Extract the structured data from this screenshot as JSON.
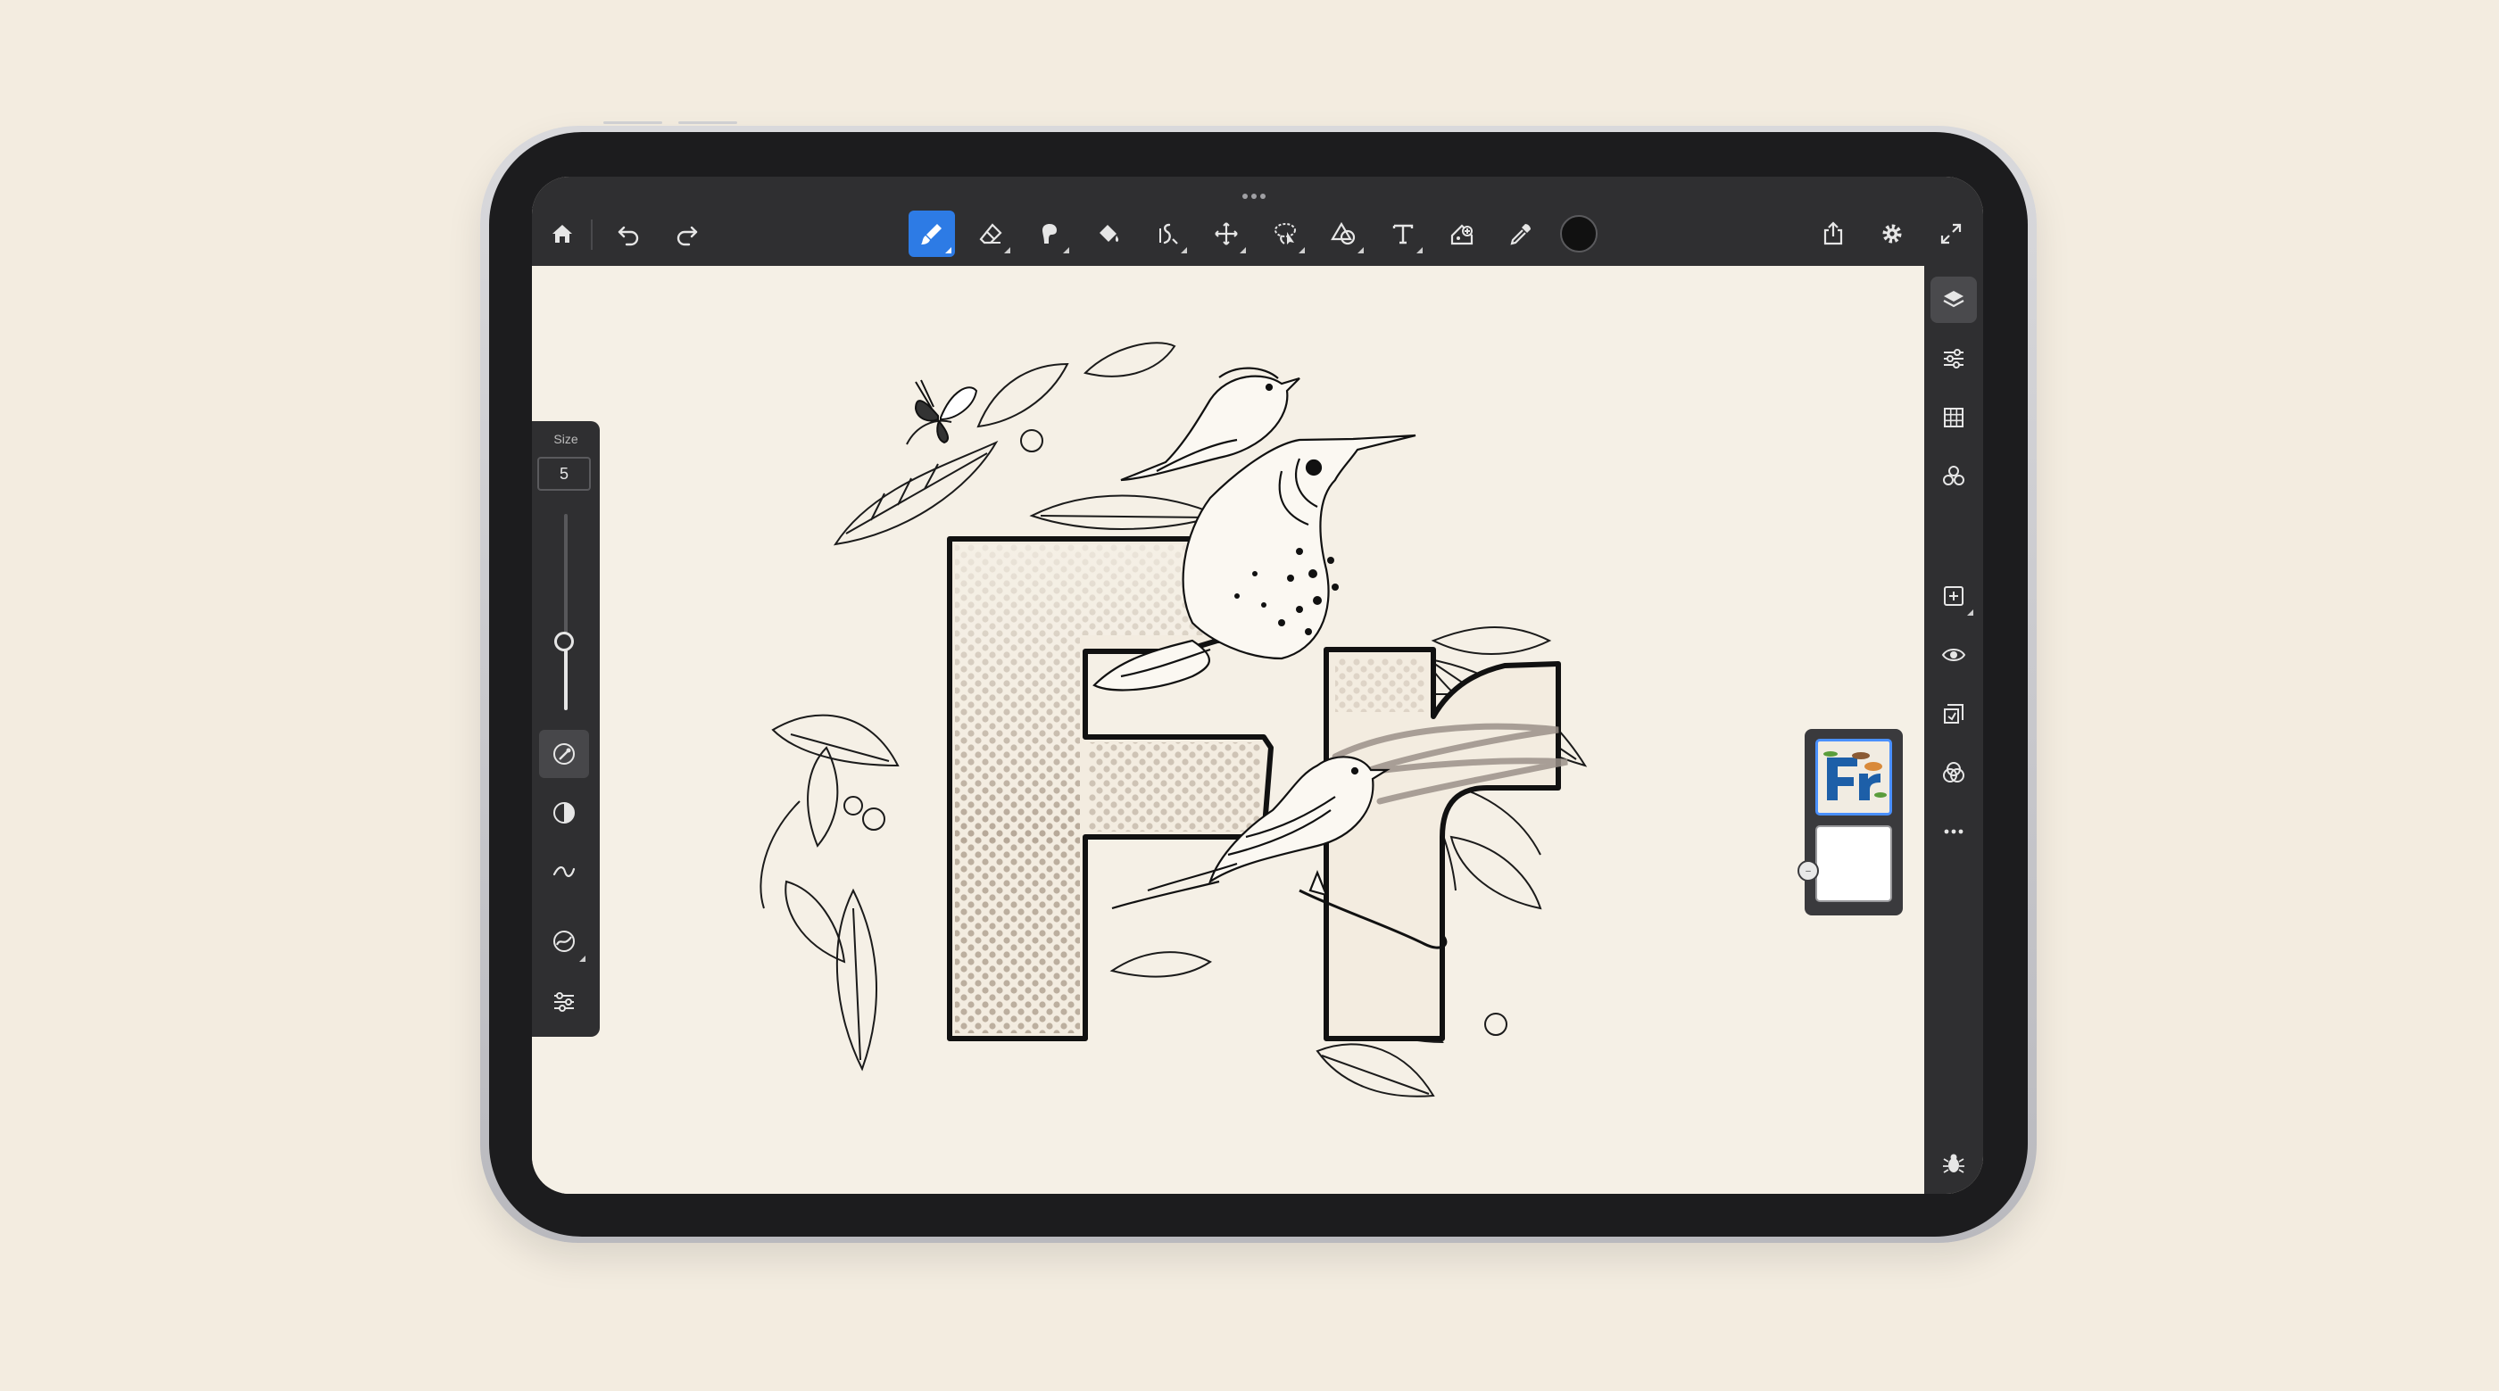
{
  "colors": {
    "background": "#f3ece0",
    "toolbar": "#2f2f31",
    "accent": "#2d7be5",
    "canvas": "#f5f0e6",
    "current_color": "#111111",
    "logo_blue": "#1d5fa8"
  },
  "toolbar": {
    "left": [
      {
        "name": "home-icon"
      },
      {
        "name": "undo-icon"
      },
      {
        "name": "redo-icon"
      }
    ],
    "tools": [
      {
        "name": "brush-tool-icon",
        "active": true
      },
      {
        "name": "eraser-tool-icon"
      },
      {
        "name": "smudge-tool-icon"
      },
      {
        "name": "fill-bucket-icon"
      },
      {
        "name": "liquify-icon"
      },
      {
        "name": "transform-icon"
      },
      {
        "name": "lasso-selection-icon"
      },
      {
        "name": "shapes-icon"
      },
      {
        "name": "text-tool-icon"
      },
      {
        "name": "place-image-icon"
      },
      {
        "name": "eyedropper-icon"
      }
    ],
    "right": [
      {
        "name": "share-icon"
      },
      {
        "name": "settings-gear-icon"
      },
      {
        "name": "fullscreen-icon"
      }
    ]
  },
  "brush_panel": {
    "size_label": "Size",
    "size_value": "5",
    "size_level": 0.35,
    "buttons": [
      {
        "name": "brush-settings-icon",
        "active": true
      },
      {
        "name": "opacity-icon"
      },
      {
        "name": "smoothing-icon"
      },
      {
        "name": "pressure-dynamics-icon"
      },
      {
        "name": "brush-adjustments-icon"
      }
    ]
  },
  "right_sidebar": {
    "top": [
      "layers-icon",
      "layer-properties-icon",
      "grid-icon",
      "color-blend-icon"
    ],
    "middle": [
      "add-layer-icon",
      "visibility-eye-icon",
      "layer-mask-icon",
      "blend-mode-icon",
      "more-options-icon"
    ],
    "bottom": [
      "bug-report-icon"
    ]
  },
  "layers": [
    {
      "name": "artwork-layer",
      "selected": true
    },
    {
      "name": "blank-layer",
      "selected": false
    }
  ],
  "artwork": {
    "letters": "Fr",
    "logo_letters": "Fr"
  }
}
